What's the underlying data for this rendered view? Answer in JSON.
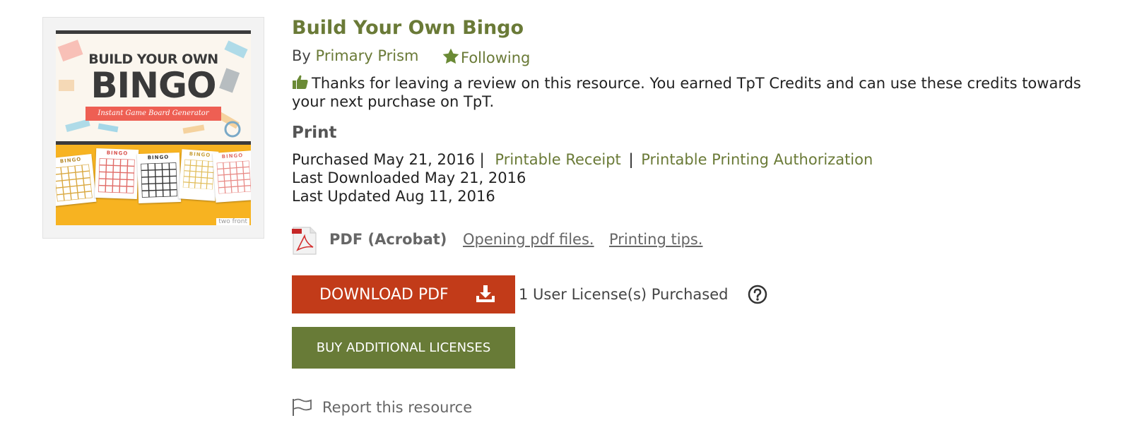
{
  "product": {
    "title": "Build Your Own Bingo",
    "by_prefix": "By",
    "author": "Primary Prism",
    "follow_label": "Following",
    "thumbnail": {
      "line1": "BUILD YOUR OWN",
      "line2": "BINGO",
      "banner": "Instant Game Board Generator",
      "card_header": "BINGO",
      "footer_tag": "two front"
    }
  },
  "notice": {
    "text": "Thanks for leaving a review on this resource. You earned TpT Credits and can use these credits towards your next purchase on TpT."
  },
  "section": {
    "heading": "Print"
  },
  "meta": {
    "purchased": "Purchased May 21, 2016 |",
    "receipt_link": "Printable Receipt",
    "separator": "|",
    "authorization_link": "Printable Printing Authorization",
    "last_downloaded": "Last Downloaded May 21, 2016",
    "last_updated": "Last Updated Aug 11, 2016"
  },
  "file": {
    "type_label": "PDF (Acrobat)",
    "opening_link": "Opening pdf files.",
    "printing_link": "Printing tips."
  },
  "actions": {
    "download_label": "DOWNLOAD PDF",
    "license_text": "1 User License(s) Purchased",
    "buy_label": "BUY ADDITIONAL LICENSES",
    "report_label": "Report this resource"
  },
  "colors": {
    "accent_green": "#6a7a37",
    "download_red": "#c23b19",
    "buy_green": "#687b37"
  },
  "icons": [
    "thumbs-up-icon",
    "star-icon",
    "pdf-icon",
    "download-icon",
    "help-icon",
    "flag-icon"
  ]
}
